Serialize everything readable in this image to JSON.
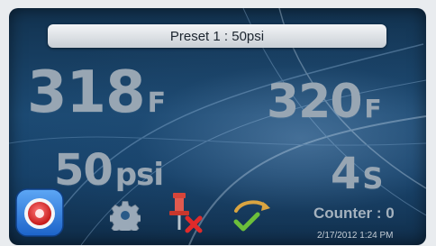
{
  "preset": {
    "label": "Preset 1 :  50psi"
  },
  "readings": {
    "temp_actual": {
      "value": "318",
      "unit": "F"
    },
    "temp_set": {
      "value": "320",
      "unit": "F"
    },
    "pressure": {
      "value": "50",
      "unit": "psi"
    },
    "time": {
      "value": "4",
      "unit": "S"
    }
  },
  "counter": {
    "label": "Counter : 0"
  },
  "datetime": "2/17/2012  1:24 PM",
  "icons": [
    "home-stop-icon",
    "gear-icon",
    "pin-clear-icon",
    "swap-confirm-icon"
  ],
  "colors": {
    "accent_red": "#e02a2a",
    "readout_gray": "#98a6b3",
    "screen_blue": "#1c4a73"
  }
}
